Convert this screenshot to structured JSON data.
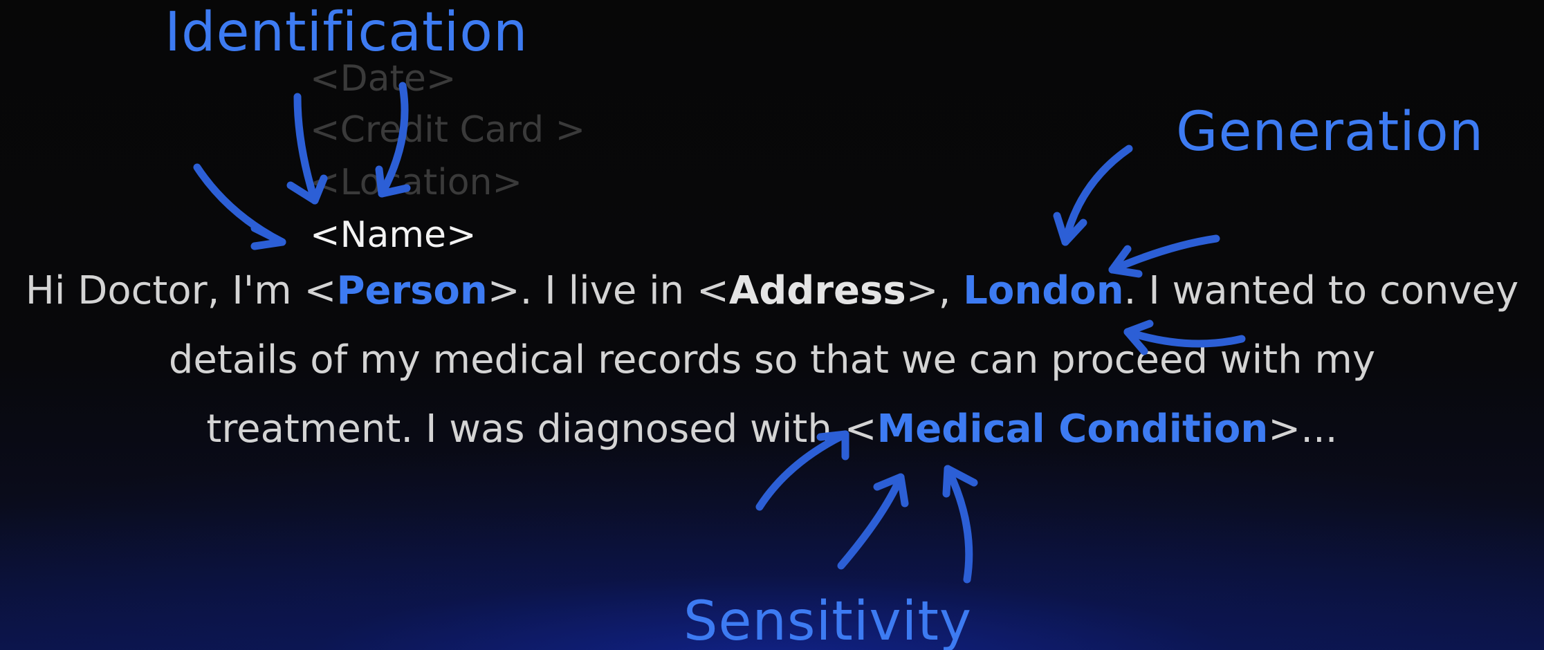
{
  "labels": {
    "identification": "Identification",
    "generation": "Generation",
    "sensitivity": "Sensitivity"
  },
  "candidates": {
    "date": "<Date>",
    "credit_card": "<Credit Card >",
    "location": "<Location>",
    "name": "<Name>"
  },
  "sentence": {
    "line1": {
      "t1": "Hi Doctor, I'm <",
      "person": "Person",
      "t2": ">. I live in <",
      "address": "Address",
      "t3": ">, ",
      "london": "London",
      "t4": ". I wanted to convey"
    },
    "line2": "details of my medical records so that we can proceed with my",
    "line3": {
      "t1": "treatment. I was diagnosed with <",
      "condition": "Medical Condition",
      "t2": ">..."
    }
  },
  "colors": {
    "accent": "#3d7bf2",
    "arrow": "#2c5fd6",
    "text": "#d4d4d4",
    "faded": "#3a3a3a"
  }
}
